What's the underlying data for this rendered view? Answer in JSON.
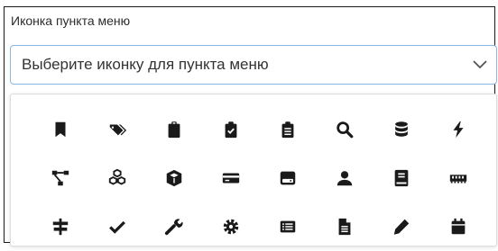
{
  "field": {
    "label": "Иконка пункта меню",
    "placeholder": "Выберите иконку для пункта меню",
    "border_color": "#8fb4e3"
  },
  "icons": [
    [
      "bookmark-icon",
      "tags-icon",
      "clipboard-icon",
      "clipboard-check-icon",
      "clipboard-list-icon",
      "search-icon",
      "database-icon",
      "bolt-icon"
    ],
    [
      "project-diagram-icon",
      "cubes-icon",
      "cube-icon",
      "credit-card-icon",
      "hdd-icon",
      "user-icon",
      "book-icon",
      "memory-icon"
    ],
    [
      "sign-icon",
      "check-icon",
      "wrench-icon",
      "cog-icon",
      "list-alt-icon",
      "file-alt-icon",
      "pencil-icon",
      "calendar-icon"
    ]
  ],
  "icon_color": "#1a1a1a"
}
